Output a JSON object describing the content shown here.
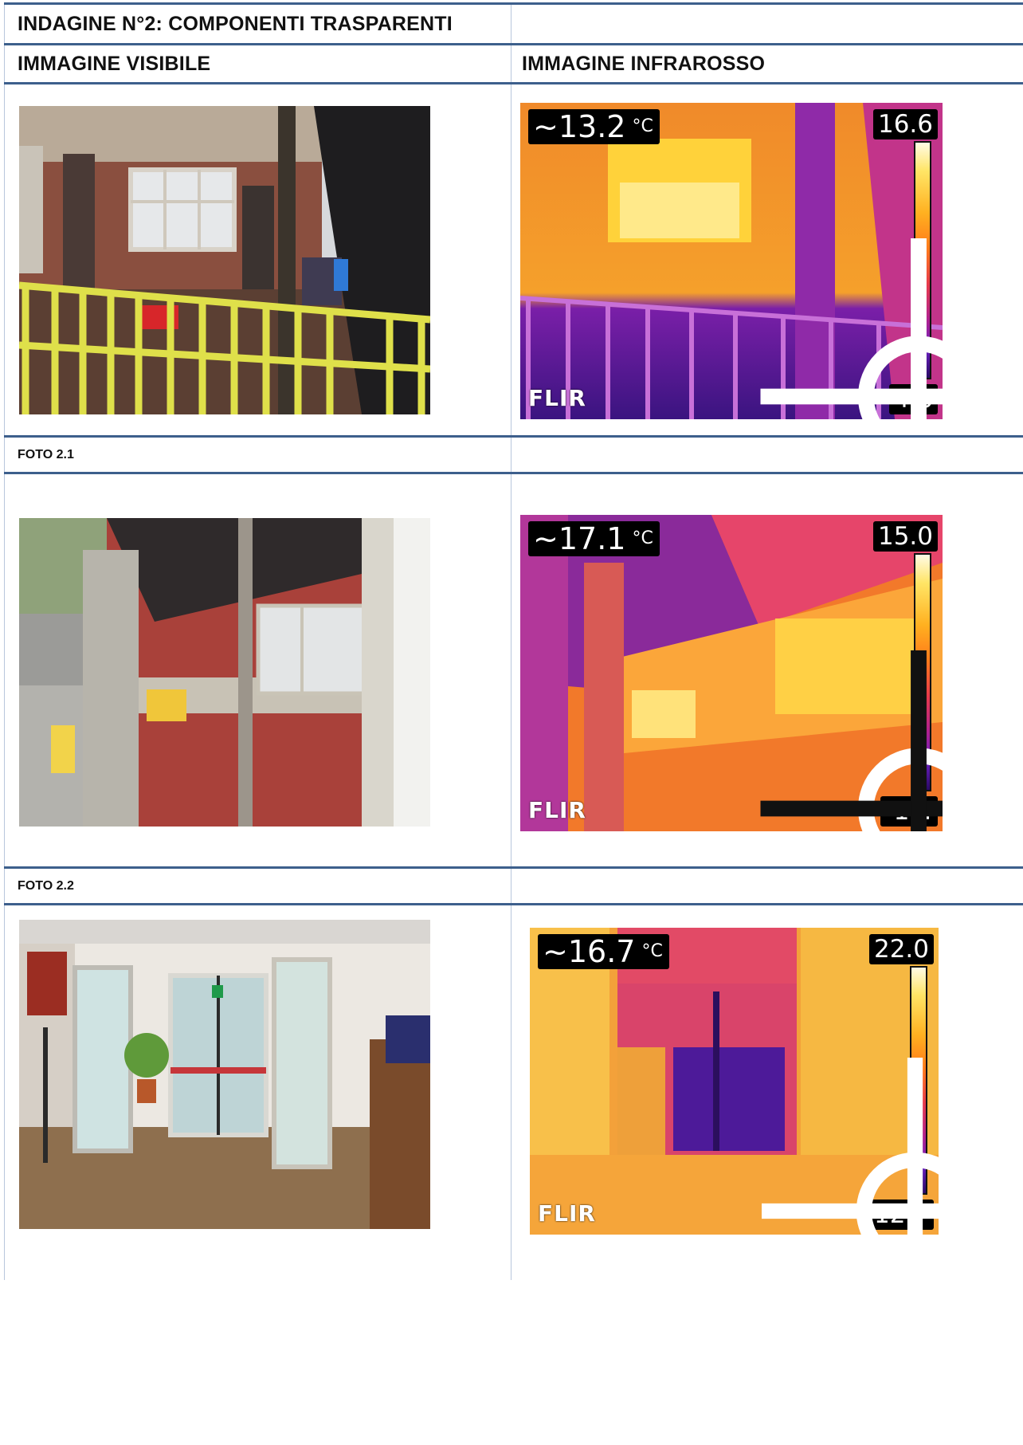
{
  "header": {
    "title": "INDAGINE N°2: COMPONENTI TRASPARENTI",
    "col_visible": "IMMAGINE VISIBILE",
    "col_infrared": "IMMAGINE INFRAROSSO"
  },
  "photos": [
    {
      "label": "FOTO 2.1",
      "ir": {
        "spot_temp": "~13.2",
        "unit": "°C",
        "scale_max": "16.6",
        "scale_min": "4.6",
        "logo": "FLIR"
      }
    },
    {
      "label": "FOTO 2.2",
      "ir": {
        "spot_temp": "~17.1",
        "unit": "°C",
        "scale_max": "15.0",
        "scale_min": "-1.4",
        "logo": "FLIR"
      }
    },
    {
      "label": "",
      "ir": {
        "spot_temp": "~16.7",
        "unit": "°C",
        "scale_max": "22.0",
        "scale_min": "12.7",
        "logo": "FLIR"
      }
    }
  ]
}
